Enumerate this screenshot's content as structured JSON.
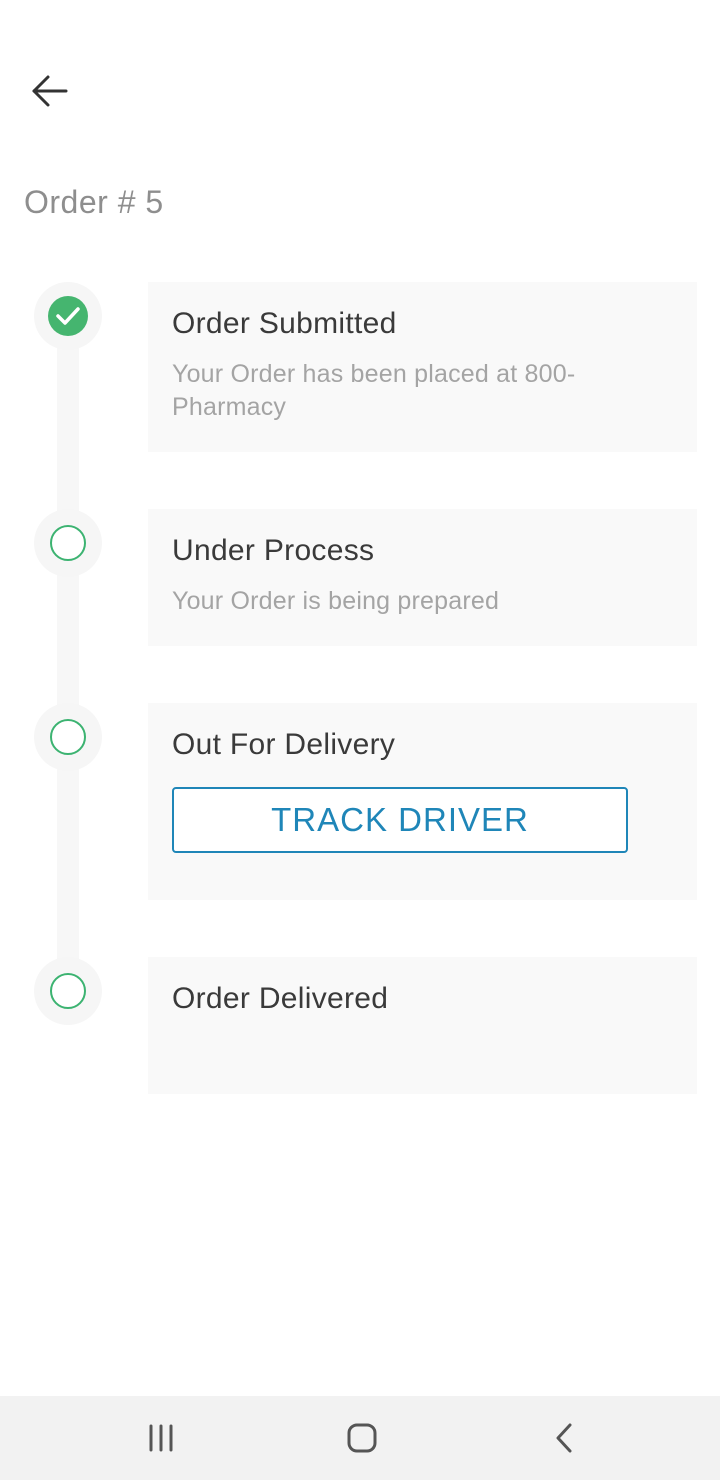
{
  "header": {
    "back_icon": "arrow-left-icon",
    "order_title": "Order # 5"
  },
  "colors": {
    "accent_green": "#45b56f",
    "button_blue": "#1f86b8",
    "card_bg": "#f9f9f9"
  },
  "steps": [
    {
      "title": "Order Submitted",
      "description": "Your Order has been placed at 800-Pharmacy",
      "status": "completed",
      "icon": "check-circle-icon"
    },
    {
      "title": "Under Process",
      "description": "Your Order is being prepared",
      "status": "pending",
      "icon": "empty-circle-icon"
    },
    {
      "title": "Out For Delivery",
      "button_label": "TRACK DRIVER",
      "status": "pending",
      "icon": "empty-circle-icon"
    },
    {
      "title": "Order Delivered",
      "status": "pending",
      "icon": "empty-circle-icon"
    }
  ],
  "system_nav": {
    "recents_icon": "recent-apps-icon",
    "home_icon": "home-icon",
    "back_icon": "back-icon"
  }
}
